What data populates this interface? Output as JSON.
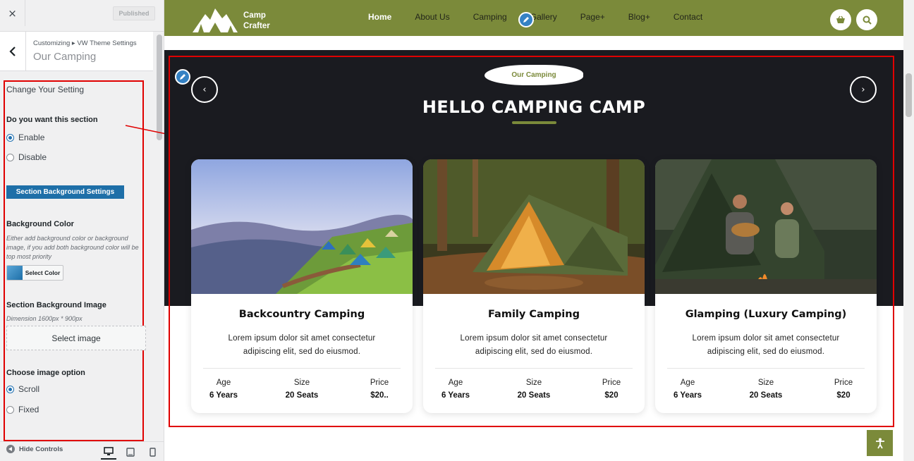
{
  "sidebar": {
    "close_icon": "×",
    "published_label": "Published",
    "breadcrumb": "Customizing ▸ VW Theme Settings",
    "title": "Our Camping",
    "heading": "Change Your Setting",
    "section_question": "Do you want this section",
    "enable_label": "Enable",
    "disable_label": "Disable",
    "enable_selected": true,
    "bg_settings_button": "Section Background Settings",
    "bg_color_title": "Background Color",
    "bg_color_desc": "Either add background color or background image, if you add both background color will be top most priority",
    "select_color_label": "Select Color",
    "bg_image_title": "Section Background Image",
    "bg_image_dim": "Dimension 1600px * 900px",
    "select_image_label": "Select image",
    "image_option_title": "Choose image option",
    "scroll_label": "Scroll",
    "fixed_label": "Fixed",
    "scroll_selected": true,
    "hide_controls": "Hide Controls"
  },
  "site": {
    "logo_line1": "Camp",
    "logo_line2": "Crafter",
    "nav": [
      "Home",
      "About Us",
      "Camping",
      "Gallery",
      "Page+",
      "Blog+",
      "Contact"
    ],
    "active_nav": "Home"
  },
  "section": {
    "badge": "Our Camping",
    "heading": "HELLO CAMPING CAMP",
    "prev_icon": "‹",
    "next_icon": "›"
  },
  "cards": [
    {
      "title": "Backcountry Camping",
      "desc": "Lorem ipsum dolor sit amet consectetur adipiscing elit, sed do eiusmod.",
      "stats": [
        {
          "label": "Age",
          "value": "6 Years"
        },
        {
          "label": "Size",
          "value": "20 Seats"
        },
        {
          "label": "Price",
          "value": "$20.."
        }
      ]
    },
    {
      "title": "Family Camping",
      "desc": "Lorem ipsum dolor sit amet consectetur adipiscing elit, sed do eiusmod.",
      "stats": [
        {
          "label": "Age",
          "value": "6 Years"
        },
        {
          "label": "Size",
          "value": "20 Seats"
        },
        {
          "label": "Price",
          "value": "$20"
        }
      ]
    },
    {
      "title": "Glamping (Luxury Camping)",
      "desc": "Lorem ipsum dolor sit amet consectetur adipiscing elit, sed do eiusmod.",
      "stats": [
        {
          "label": "Age",
          "value": "6 Years"
        },
        {
          "label": "Size",
          "value": "20 Seats"
        },
        {
          "label": "Price",
          "value": "$20"
        }
      ]
    }
  ],
  "colors": {
    "brand_olive": "#7b8a3a",
    "section_dark": "#1a1b20",
    "highlight_red": "#e00000",
    "wp_blue": "#2271b1"
  },
  "icons": [
    "close-icon",
    "chevron-left-icon",
    "cart-icon",
    "search-icon",
    "edit-pencil-icon",
    "accessibility-icon",
    "desktop-icon",
    "tablet-icon",
    "mobile-icon"
  ]
}
